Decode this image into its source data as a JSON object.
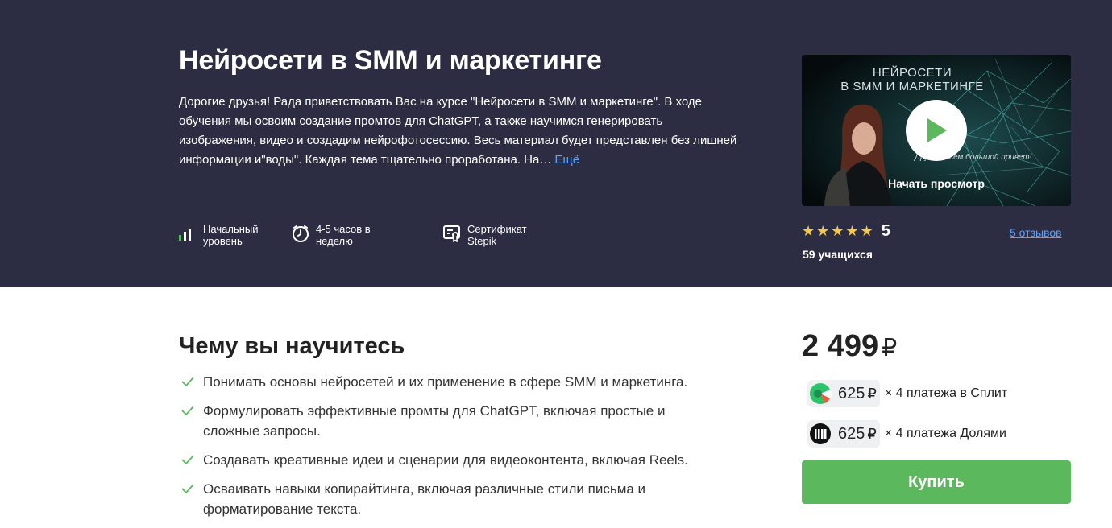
{
  "course": {
    "title": "Нейросети в SMM и маркетинге",
    "description": "Дорогие друзья! Рада приветствовать Вас на курсе \"Нейросети в SMM и маркетинге\". В ходе обучения мы освоим создание промтов для ChatGPT, а также научимся генерировать изображения, видео и создадим нейрофотосессию. Весь материал будет представлен без лишней информации и\"воды\". Каждая тема тщательно проработана. На…",
    "more_label": "Ещё"
  },
  "features": [
    {
      "icon": "level-bars-icon",
      "label": "Начальный уровень"
    },
    {
      "icon": "clock-icon",
      "label": "4-5 часов в неделю"
    },
    {
      "icon": "certificate-icon",
      "label": "Сертификат Stepik"
    }
  ],
  "video": {
    "title_line1": "НЕЙРОСЕТИ",
    "title_line2": "В SMM И МАРКЕТИНГЕ",
    "greeting": "Друзья, всем большой привет!",
    "caption": "Начать просмотр"
  },
  "rating": {
    "stars": "★★★★★",
    "value": "5",
    "reviews_label": "5 отзывов",
    "students_label": "59 учащихся",
    "star_color": "#f7c948"
  },
  "learn": {
    "heading": "Чему вы научитесь",
    "items": [
      "Понимать основы нейросетей и их применение в сфере SMM и маркетинга.",
      "Формулировать эффективные промты для ChatGPT, включая простые и сложные запросы.",
      "Создавать креативные идеи и сценарии для видеоконтента, включая Reels.",
      "Осваивать навыки копирайтинга, включая различные стили письма и форматирование текста."
    ]
  },
  "purchase": {
    "price": "2 499",
    "currency": "₽",
    "split": {
      "amount": "625",
      "currency": "₽",
      "label": "× 4 платежа в Сплит",
      "icon": "split-logo-icon"
    },
    "dolyami": {
      "amount": "625",
      "currency": "₽",
      "label": "× 4 платежа Долями",
      "icon": "dolyami-logo-icon"
    },
    "buy_label": "Купить",
    "buy_color": "#5cb85c"
  }
}
